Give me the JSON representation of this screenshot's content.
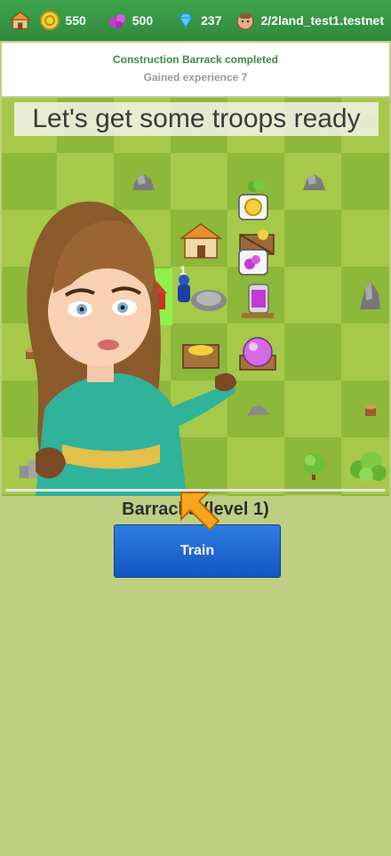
{
  "topbar": {
    "gold": "550",
    "elixir": "500",
    "gems": "237",
    "builders": "2/2",
    "account": "land_test1.testnet",
    "icons": [
      "home-icon",
      "gold-coin-icon",
      "elixir-icon",
      "gem-icon",
      "builder-icon"
    ]
  },
  "notification": {
    "title": "Construction Barrack completed",
    "subtitle": "Gained experience 7"
  },
  "map": {
    "tutorial_text": "Let's get some troops ready",
    "troop_count_label": "1"
  },
  "panel": {
    "building_title": "Barracks (level 1)",
    "train_label": "Train"
  },
  "colors": {
    "topbar": "#3fa34d",
    "grass_light": "#a6c94a",
    "grass_dark": "#8db83a",
    "button": "#1f6bd6",
    "panel_bg": "#bfcf82"
  }
}
